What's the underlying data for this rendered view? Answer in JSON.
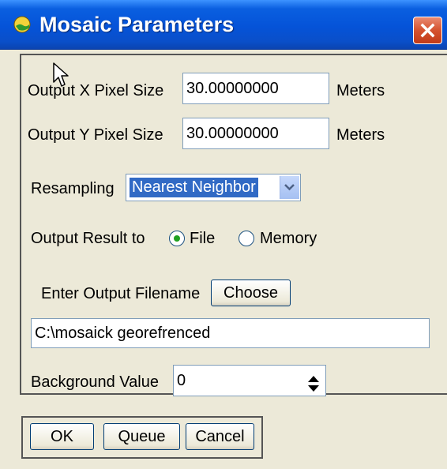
{
  "window": {
    "title": "Mosaic Parameters",
    "icons": {
      "app": "globe-icon",
      "close": "close-icon"
    }
  },
  "form": {
    "x_pixel": {
      "label": "Output X Pixel Size",
      "value": "30.00000000",
      "unit": "Meters"
    },
    "y_pixel": {
      "label": "Output Y Pixel Size",
      "value": "30.00000000",
      "unit": "Meters"
    },
    "resampling": {
      "label": "Resampling",
      "selected": "Nearest Neighbor"
    },
    "output_result": {
      "label": "Output Result to",
      "options": [
        "File",
        "Memory"
      ],
      "selected": "File"
    },
    "filename": {
      "label": "Enter Output Filename",
      "choose_label": "Choose",
      "value": "C:\\mosaick georefrenced"
    },
    "background": {
      "label": "Background Value",
      "value": "0"
    }
  },
  "buttons": {
    "ok": "OK",
    "queue": "Queue",
    "cancel": "Cancel"
  },
  "colors": {
    "title_bar": "#0553d8",
    "dialog_bg": "#ece9d8",
    "selection": "#316ac5",
    "close": "#d5522f"
  }
}
